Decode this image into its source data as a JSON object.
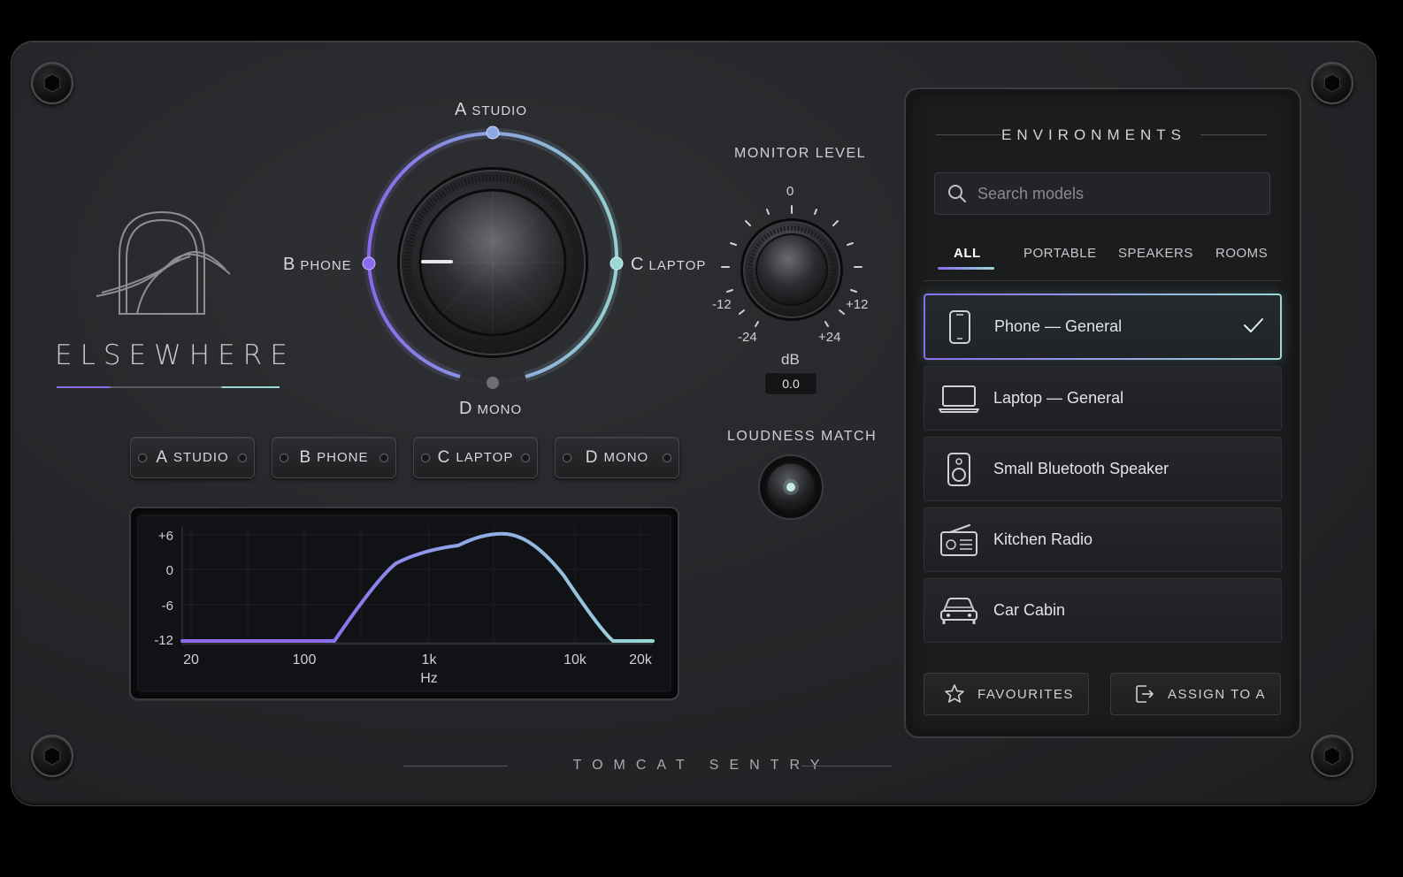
{
  "brand": {
    "name": "ELSEWHERE",
    "maker": "TOMCAT SENTRY"
  },
  "selector": {
    "a": {
      "letter": "A",
      "label": "STUDIO"
    },
    "b": {
      "letter": "B",
      "label": "PHONE"
    },
    "c": {
      "letter": "C",
      "label": "LAPTOP"
    },
    "d": {
      "letter": "D",
      "label": "MONO"
    }
  },
  "slots": [
    {
      "letter": "A",
      "label": "STUDIO"
    },
    {
      "letter": "B",
      "label": "PHONE"
    },
    {
      "letter": "C",
      "label": "LAPTOP"
    },
    {
      "letter": "D",
      "label": "MONO"
    }
  ],
  "eq": {
    "y_ticks": [
      "+6",
      "0",
      "-6",
      "-12"
    ],
    "x_ticks": [
      "20",
      "100",
      "1k",
      "10k",
      "20k"
    ],
    "x_unit": "Hz"
  },
  "monitor": {
    "title": "MONITOR LEVEL",
    "ticks": {
      "top": "0",
      "l1": "-12",
      "r1": "+12",
      "l2": "-24",
      "r2": "+24"
    },
    "unit": "dB",
    "value": "0.0"
  },
  "loudness": {
    "title": "LOUDNESS MATCH"
  },
  "environments": {
    "title": "ENVIRONMENTS",
    "search_placeholder": "Search models",
    "tabs": [
      "ALL",
      "PORTABLE",
      "SPEAKERS",
      "ROOMS"
    ],
    "active_tab": "ALL",
    "models": [
      {
        "name": "Phone — General",
        "icon": "phone-icon",
        "selected": true
      },
      {
        "name": "Laptop — General",
        "icon": "laptop-icon",
        "selected": false
      },
      {
        "name": "Small Bluetooth Speaker",
        "icon": "speaker-icon",
        "selected": false
      },
      {
        "name": "Kitchen Radio",
        "icon": "radio-icon",
        "selected": false
      },
      {
        "name": "Car Cabin",
        "icon": "car-icon",
        "selected": false
      }
    ],
    "favourites_label": "FAVOURITES",
    "assign_label": "ASSIGN TO A"
  },
  "colors": {
    "accent_purple": "#8b6cf0",
    "accent_teal": "#9ad8d6",
    "panel": "#26272a"
  }
}
